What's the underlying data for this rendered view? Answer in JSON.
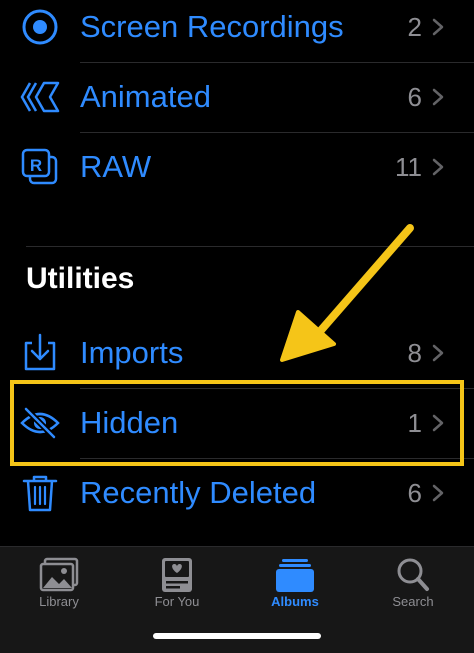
{
  "albums": [
    {
      "label": "Screen Recordings",
      "count": "2",
      "icon": "screen-recording-icon"
    },
    {
      "label": "Animated",
      "count": "6",
      "icon": "animated-icon"
    },
    {
      "label": "RAW",
      "count": "11",
      "icon": "raw-icon"
    }
  ],
  "utilities": {
    "title": "Utilities",
    "items": [
      {
        "label": "Imports",
        "count": "8",
        "icon": "import-icon"
      },
      {
        "label": "Hidden",
        "count": "1",
        "icon": "eye-slash-icon"
      },
      {
        "label": "Recently Deleted",
        "count": "6",
        "icon": "trash-icon"
      }
    ]
  },
  "tabs": [
    {
      "label": "Library",
      "icon": "photo-library-icon",
      "active": false
    },
    {
      "label": "For You",
      "icon": "for-you-icon",
      "active": false
    },
    {
      "label": "Albums",
      "icon": "albums-icon",
      "active": true
    },
    {
      "label": "Search",
      "icon": "search-icon",
      "active": false
    }
  ],
  "colors": {
    "accent": "#2f8bff",
    "highlight": "#f5c518",
    "muted": "#8e8e93",
    "background": "#000000"
  }
}
